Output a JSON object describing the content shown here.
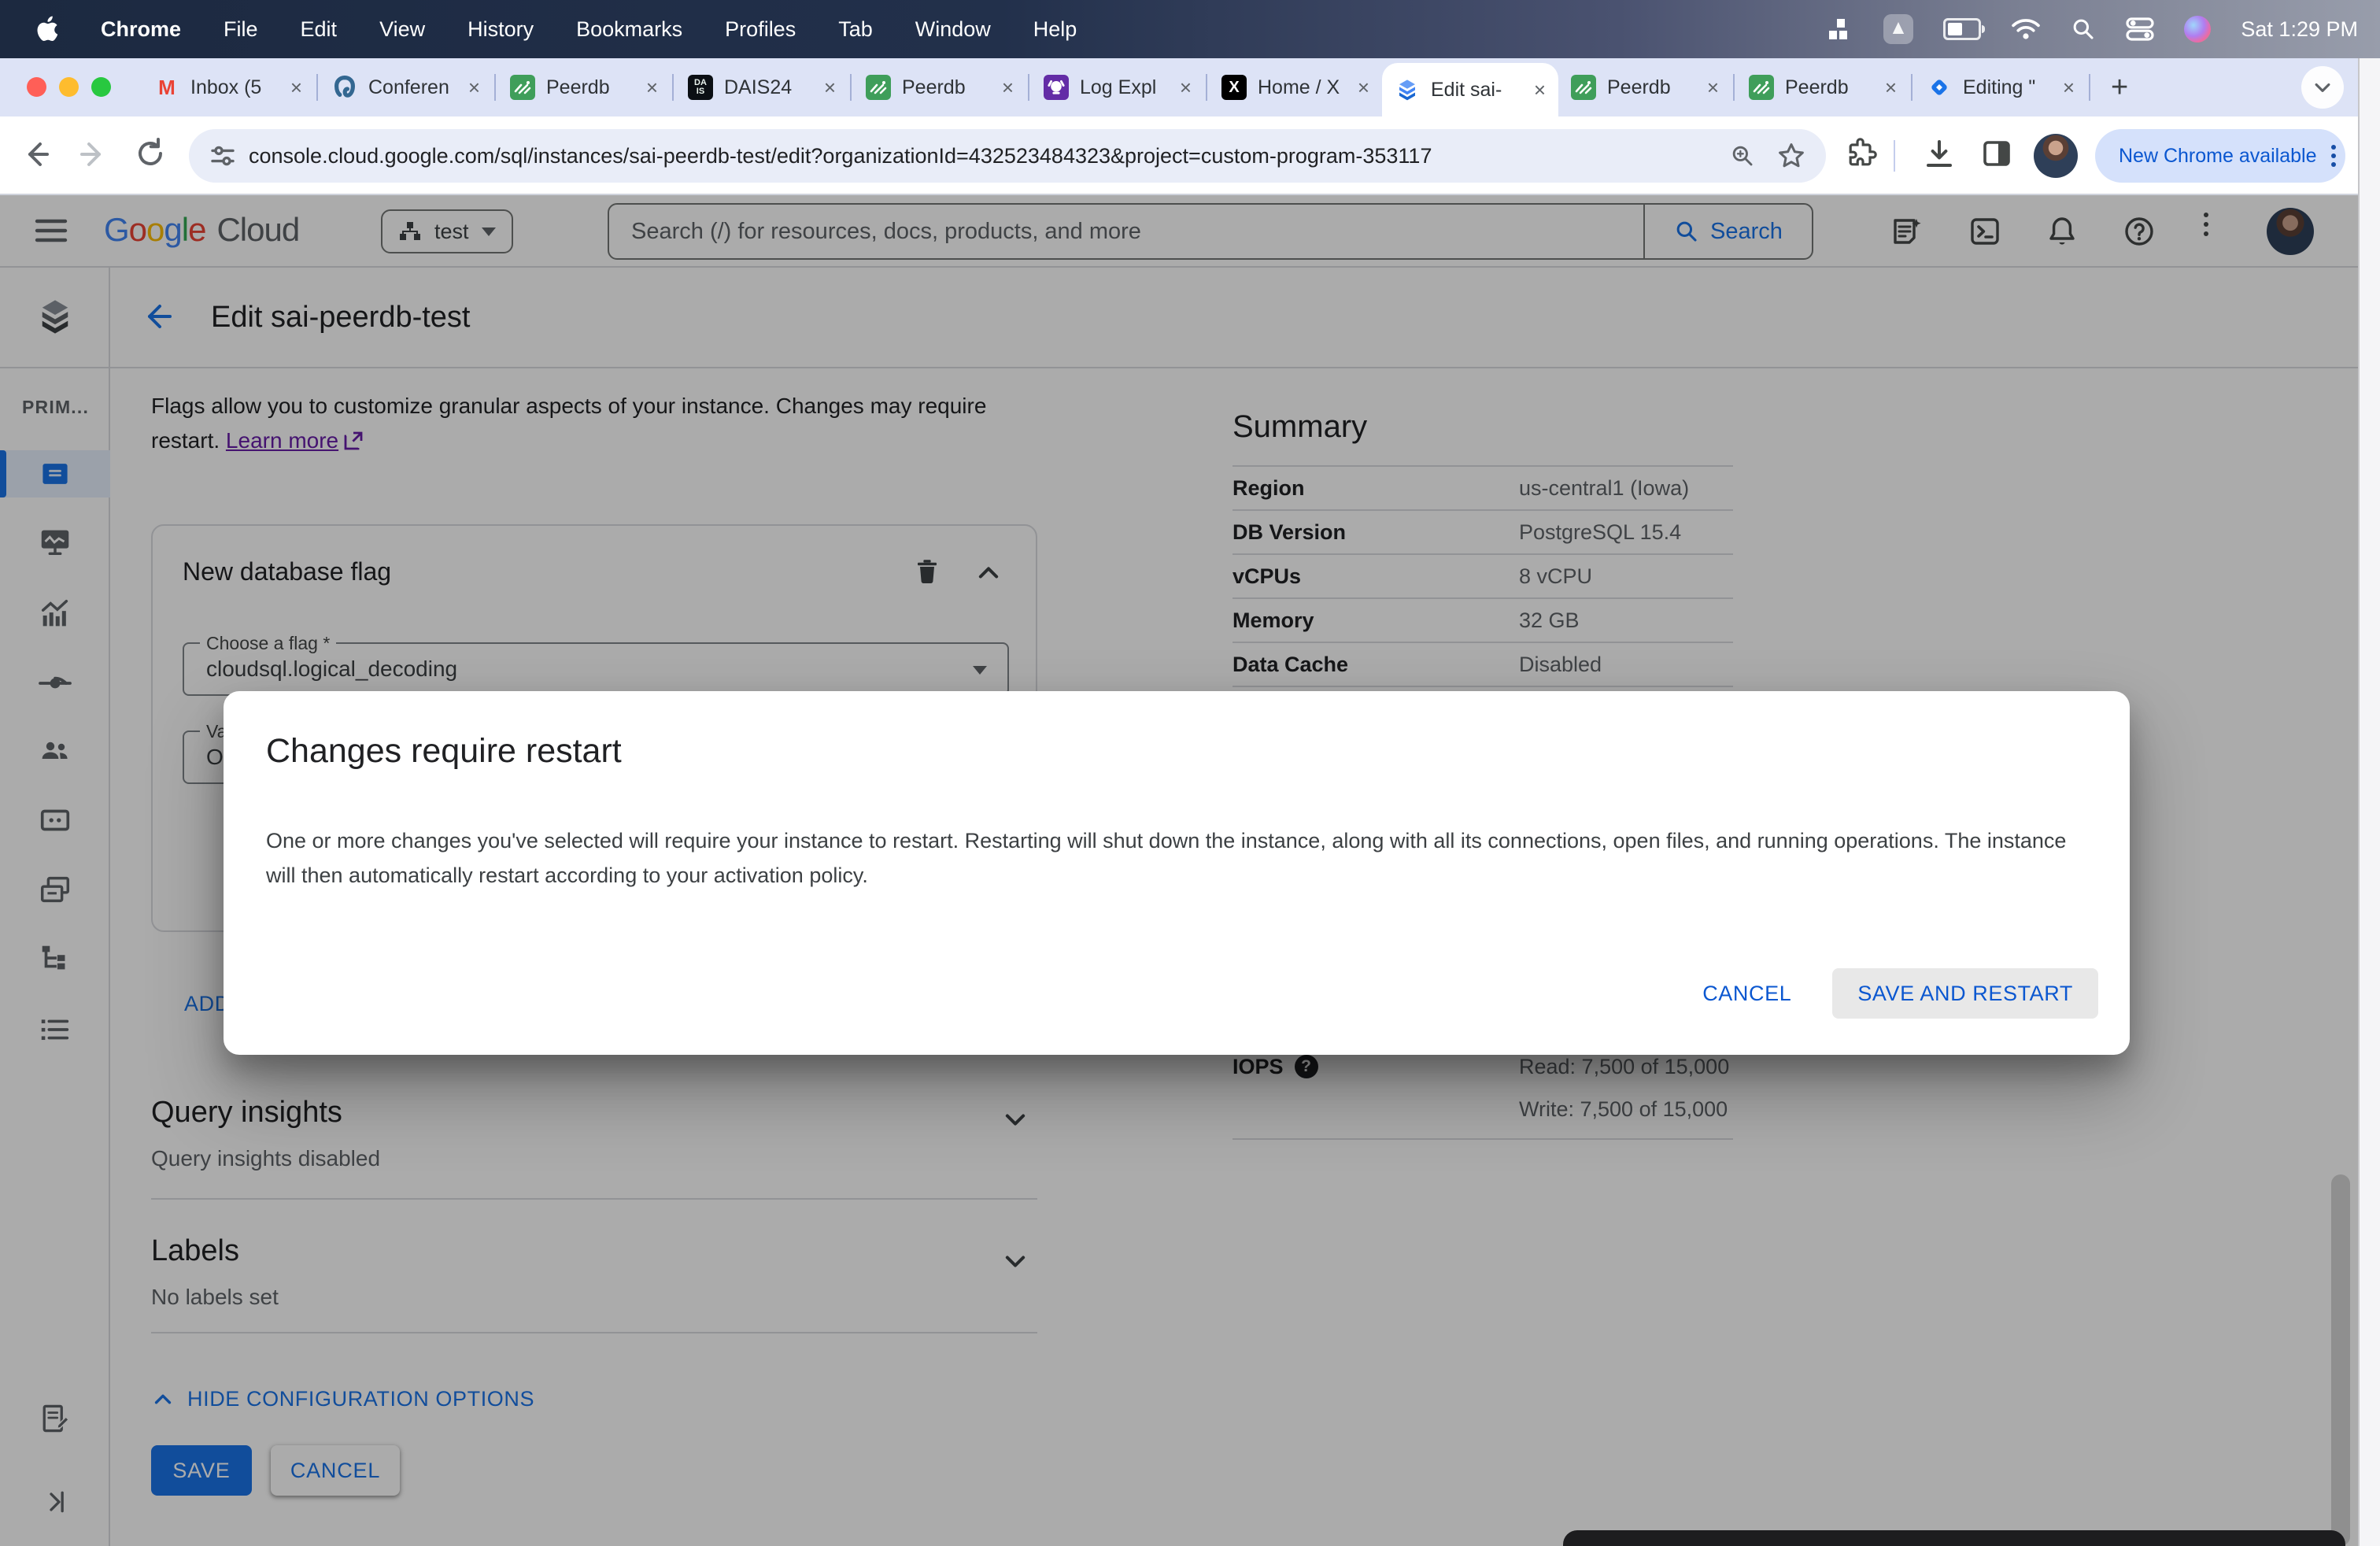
{
  "menu_bar": {
    "items": [
      "Chrome",
      "File",
      "Edit",
      "View",
      "History",
      "Bookmarks",
      "Profiles",
      "Tab",
      "Window",
      "Help"
    ],
    "clock": "Sat 1:29 PM"
  },
  "icons": {
    "close_tab": "×",
    "new_tab": "+"
  },
  "tabs": [
    {
      "title": "Inbox (5"
    },
    {
      "title": "Conferen"
    },
    {
      "title": "Peerdb"
    },
    {
      "title": "DAIS24"
    },
    {
      "title": "Peerdb"
    },
    {
      "title": "Log Expl"
    },
    {
      "title": "Home / X"
    },
    {
      "title": "Edit sai-"
    },
    {
      "title": "Peerdb"
    },
    {
      "title": "Peerdb"
    },
    {
      "title": "Editing \""
    }
  ],
  "toolbar": {
    "url": "console.cloud.google.com/sql/instances/sai-peerdb-test/edit?organizationId=432523484323&project=custom-program-353117",
    "update_pill": "New Chrome available"
  },
  "gcloud": {
    "logo_letters": [
      "G",
      "o",
      "o",
      "g",
      "l",
      "e"
    ],
    "logo_cloud": "Cloud",
    "project": "test",
    "search_placeholder": "Search (/) for resources, docs, products, and more",
    "search_button": "Search"
  },
  "page": {
    "title": "Edit sai-peerdb-test",
    "sidebar_label": "PRIM..."
  },
  "flags": {
    "intro": "Flags allow you to customize granular aspects of your instance. Changes may require restart.",
    "learn_more": "Learn more"
  },
  "flag_card": {
    "title": "New database flag",
    "flag_label": "Choose a flag *",
    "flag_value": "cloudsql.logical_decoding",
    "value_label": "Va",
    "value_value": "On",
    "add_button": "ADD"
  },
  "query_insights": {
    "title": "Query insights",
    "subtitle": "Query insights disabled"
  },
  "labels_section": {
    "title": "Labels",
    "subtitle": "No labels set"
  },
  "footer": {
    "hide_link": "HIDE CONFIGURATION OPTIONS",
    "save": "SAVE",
    "cancel": "CANCEL"
  },
  "summary": {
    "title": "Summary",
    "rows": [
      {
        "label": "Region",
        "value": "us-central1 (Iowa)"
      },
      {
        "label": "DB Version",
        "value": "PostgreSQL 15.4"
      },
      {
        "label": "vCPUs",
        "value": "8 vCPU"
      },
      {
        "label": "Memory",
        "value": "32 GB"
      },
      {
        "label": "Data Cache",
        "value": "Disabled"
      }
    ],
    "iops_label": "IOPS",
    "iops_read": "Read: 7,500 of 15,000",
    "iops_write": "Write: 7,500 of 15,000"
  },
  "modal": {
    "title": "Changes require restart",
    "body": "One or more changes you've selected will require your instance to restart. Restarting will shut down the instance, along with all its connections, open files, and running operations. The instance will then automatically restart according to your activation policy.",
    "cancel": "CANCEL",
    "confirm": "SAVE AND RESTART"
  },
  "colors": {
    "accent_blue": "#1a73e8",
    "modal_blue": "#0b57d0",
    "link_purple": "#681da8",
    "scrim": "rgba(0,0,0,0.33)",
    "tabstrip_bg": "#dde3f6"
  }
}
